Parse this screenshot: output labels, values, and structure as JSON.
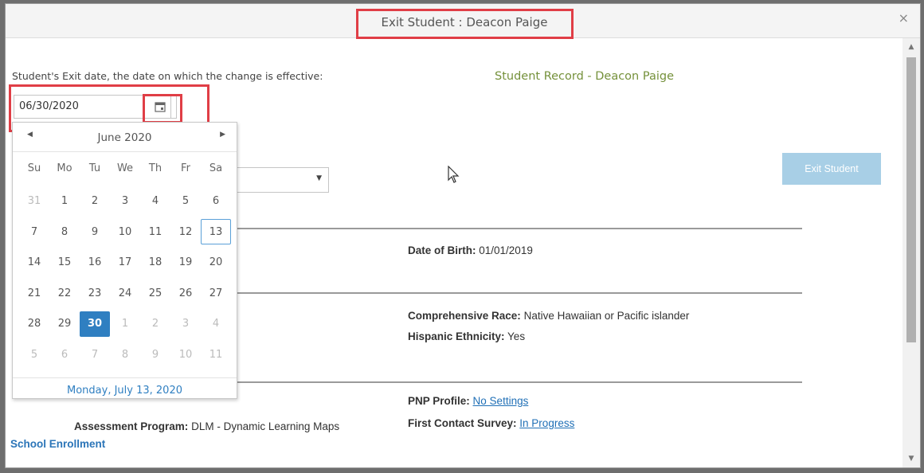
{
  "dialog": {
    "title": "Exit Student : Deacon Paige",
    "close_symbol": "×"
  },
  "form": {
    "exit_date_label": "Student's Exit date, the date on which the change is effective:",
    "exit_date_value": "06/30/2020",
    "record_title": "Student Record - Deacon Paige",
    "exit_button_label": "Exit Student"
  },
  "calendar": {
    "month_label": "June 2020",
    "weekdays": [
      "Su",
      "Mo",
      "Tu",
      "We",
      "Th",
      "Fr",
      "Sa"
    ],
    "weeks": [
      [
        "31",
        "1",
        "2",
        "3",
        "4",
        "5",
        "6"
      ],
      [
        "7",
        "8",
        "9",
        "10",
        "11",
        "12",
        "13"
      ],
      [
        "14",
        "15",
        "16",
        "17",
        "18",
        "19",
        "20"
      ],
      [
        "21",
        "22",
        "23",
        "24",
        "25",
        "26",
        "27"
      ],
      [
        "28",
        "29",
        "30",
        "1",
        "2",
        "3",
        "4"
      ],
      [
        "5",
        "6",
        "7",
        "8",
        "9",
        "10",
        "11"
      ]
    ],
    "today_footer": "Monday, July 13, 2020"
  },
  "details": {
    "dob_label": "Date of Birth:",
    "dob_value": "01/01/2019",
    "race_label": "Comprehensive Race:",
    "race_value": "Native Hawaiian or Pacific islander",
    "hispanic_label": "Hispanic Ethnicity:",
    "hispanic_value": "Yes",
    "pnp_label": "PNP Profile:",
    "pnp_value": "No Settings",
    "fcs_label": "First Contact Survey:",
    "fcs_value": "In Progress",
    "assessment_label": "Assessment Program:",
    "assessment_value": "DLM - Dynamic Learning Maps",
    "school_enrollment": "School Enrollment"
  },
  "colors": {
    "highlight": "#e03e46",
    "accent": "#2f7fc1",
    "record_title": "#75913b"
  }
}
